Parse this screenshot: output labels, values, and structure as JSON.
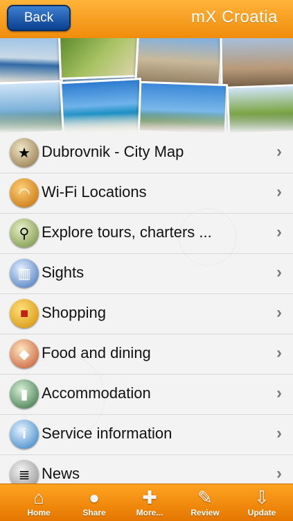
{
  "header": {
    "back_label": "Back",
    "title": "mX Croatia"
  },
  "menu": [
    {
      "label": "Dubrovnik - City Map",
      "icon": "map-icon"
    },
    {
      "label": "Wi-Fi Locations",
      "icon": "wifi-icon"
    },
    {
      "label": "Explore tours, charters ...",
      "icon": "magnifier-icon"
    },
    {
      "label": "Sights",
      "icon": "colosseum-icon"
    },
    {
      "label": "Shopping",
      "icon": "shopping-bag-icon"
    },
    {
      "label": "Food and dining",
      "icon": "food-icon"
    },
    {
      "label": "Accommodation",
      "icon": "hotel-icon"
    },
    {
      "label": "Service information",
      "icon": "info-icon"
    },
    {
      "label": "News",
      "icon": "newspaper-icon"
    }
  ],
  "tabbar": {
    "home": "Home",
    "share": "Share",
    "more": "More...",
    "review": "Review",
    "update": "Update"
  }
}
